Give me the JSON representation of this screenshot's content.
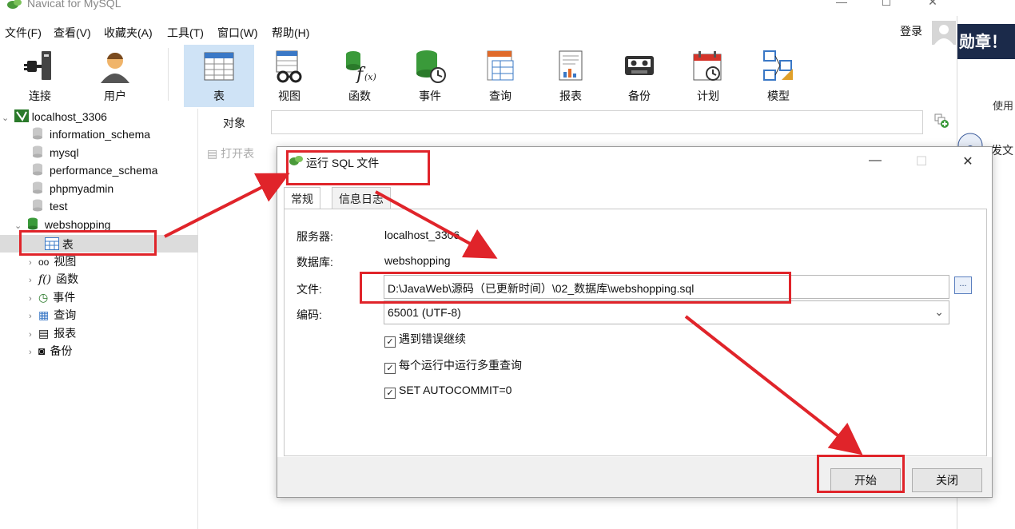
{
  "window": {
    "title": "Navicat for MySQL",
    "minimize": "—",
    "maximize": "☐",
    "close": "✕"
  },
  "menu": [
    "文件(F)",
    "查看(V)",
    "收藏夹(A)",
    "工具(T)",
    "窗口(W)",
    "帮助(H)"
  ],
  "login": "登录",
  "toolbar": [
    {
      "label": "连接",
      "icon": "plug-icon"
    },
    {
      "label": "用户",
      "icon": "user-icon"
    },
    {
      "label": "表",
      "icon": "table-icon",
      "active": true
    },
    {
      "label": "视图",
      "icon": "view-icon"
    },
    {
      "label": "函数",
      "icon": "function-icon"
    },
    {
      "label": "事件",
      "icon": "event-icon"
    },
    {
      "label": "查询",
      "icon": "query-icon"
    },
    {
      "label": "报表",
      "icon": "report-icon"
    },
    {
      "label": "备份",
      "icon": "backup-icon"
    },
    {
      "label": "计划",
      "icon": "schedule-icon"
    },
    {
      "label": "模型",
      "icon": "model-icon"
    }
  ],
  "tree": {
    "connection": "localhost_3306",
    "databases": [
      "information_schema",
      "mysql",
      "performance_schema",
      "phpmyadmin",
      "test",
      "webshopping"
    ],
    "children": [
      "表",
      "视图",
      "函数",
      "事件",
      "查询",
      "报表",
      "备份"
    ]
  },
  "object": {
    "label": "对象",
    "open_table": "打开表"
  },
  "right": {
    "banner": "勋章！",
    "use": "使用",
    "post": "发文"
  },
  "dialog": {
    "title": "运行 SQL 文件",
    "tabs": [
      "常规",
      "信息日志"
    ],
    "server_label": "服务器:",
    "server_value": "localhost_3306",
    "database_label": "数据库:",
    "database_value": "webshopping",
    "file_label": "文件:",
    "file_value": "D:\\JavaWeb\\源码（已更新时间）\\02_数据库\\webshopping.sql",
    "encoding_label": "编码:",
    "encoding_value": "65001 (UTF-8)",
    "browse": "...",
    "options": [
      {
        "label": "遇到错误继续",
        "checked": true
      },
      {
        "label": "每个运行中运行多重查询",
        "checked": true
      },
      {
        "label": "SET AUTOCOMMIT=0",
        "checked": true
      }
    ],
    "start": "开始",
    "close": "关闭"
  },
  "colors": {
    "accent": "#cfe3f6",
    "annotation": "#e0242a",
    "brand": "#3a8a3a"
  }
}
